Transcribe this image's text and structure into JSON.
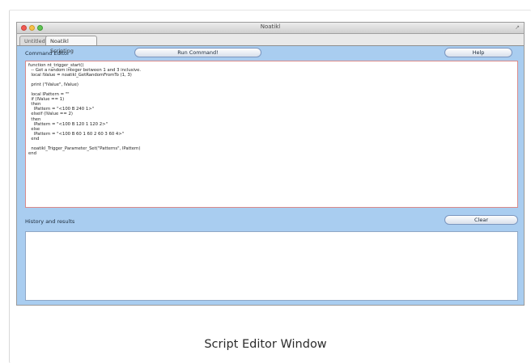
{
  "window": {
    "title": "Noatikl",
    "tabs": [
      {
        "label": "Untitled"
      },
      {
        "label": "Noatikl Scripting"
      }
    ]
  },
  "editor": {
    "label": "Command Editor",
    "run_label": "Run Command!",
    "help_label": "Help",
    "code": "function nt_trigger_start()\n  -- Get a random integer between 1 and 3 inclusive.\n  local lValue = noatikl_GetRandomFromTo (1, 3)\n\n  print (\"lValue\", lValue)\n\n  local lPattern = \"\"\n  if (lValue == 1)\n  then\n    lPattern = \"<100 B 240 1>\"\n  elseif (lValue == 2)\n  then\n    lPattern = \"<100 B 120 1 120 2>\"\n  else\n    lPattern = \"<100 B 60 1 60 2 60 3 60 4>\"\n  end\n\n  noatikl_Trigger_Parameter_Set(\"Patterns\", lPattern)\nend"
  },
  "history": {
    "label": "History and results",
    "clear_label": "Clear"
  },
  "caption": "Script Editor Window"
}
